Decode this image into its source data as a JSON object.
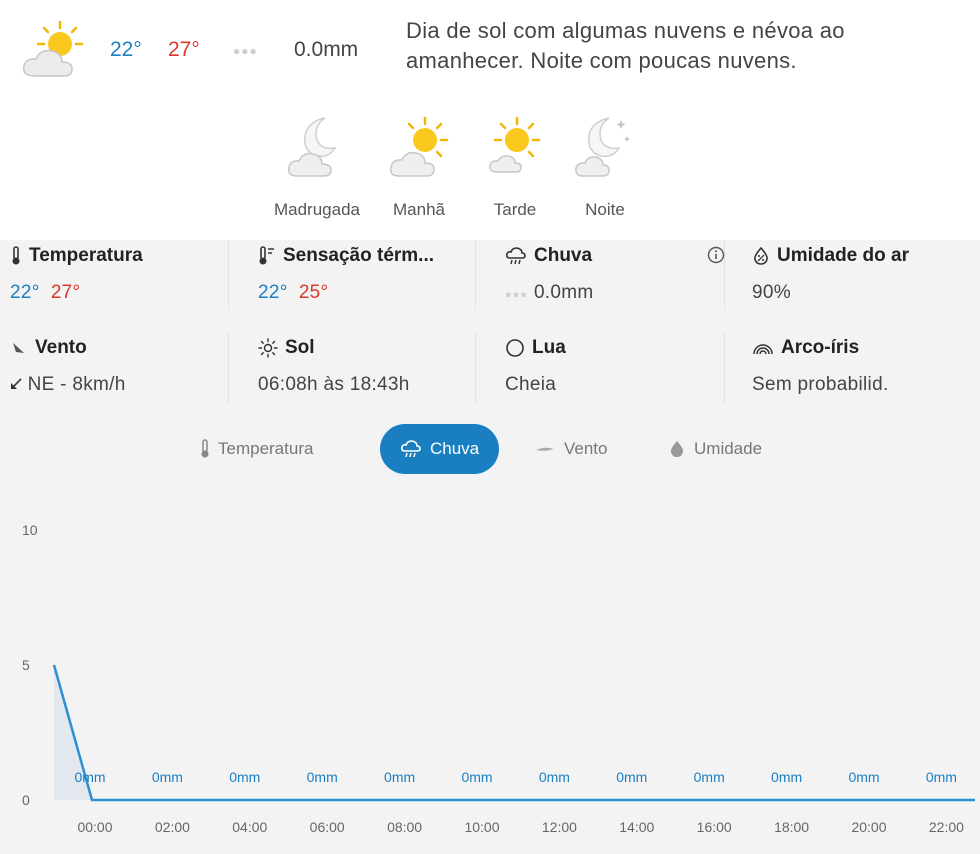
{
  "summary": {
    "temp_min": "22°",
    "temp_max": "27°",
    "rain_dots": "●●●",
    "rain": "0.0mm",
    "description": "Dia de sol com algumas nuvens e névoa ao amanhecer. Noite com poucas nuvens.",
    "icon": "sun-behind-cloud-icon"
  },
  "periods": [
    {
      "label": "Madrugada",
      "icon": "moon-cloud-icon"
    },
    {
      "label": "Manhã",
      "icon": "sun-cloud-icon"
    },
    {
      "label": "Tarde",
      "icon": "sun-small-cloud-icon"
    },
    {
      "label": "Noite",
      "icon": "moon-stars-icon"
    }
  ],
  "details": {
    "temperatura": {
      "title": "Temperatura",
      "min": "22°",
      "max": "27°"
    },
    "sensacao": {
      "title": "Sensação térm...",
      "min": "22°",
      "max": "25°"
    },
    "chuva": {
      "title": "Chuva",
      "dots": "●●●",
      "value": "0.0mm"
    },
    "umidade": {
      "title": "Umidade do ar",
      "value": "90%"
    },
    "vento": {
      "title": "Vento",
      "value": "NE - 8km/h"
    },
    "sol": {
      "title": "Sol",
      "value": "06:08h às 18:43h"
    },
    "lua": {
      "title": "Lua",
      "value": "Cheia"
    },
    "arco": {
      "title": "Arco-íris",
      "value": "Sem probabilid."
    }
  },
  "tabs": [
    {
      "label": "Temperatura",
      "active": false
    },
    {
      "label": "Chuva",
      "active": true
    },
    {
      "label": "Vento",
      "active": false
    },
    {
      "label": "Umidade",
      "active": false
    }
  ],
  "colors": {
    "accent": "#1a7fc1",
    "max": "#d9372b",
    "line": "#2b8fd6"
  },
  "chart_data": {
    "type": "area",
    "x": [
      "00:00",
      "02:00",
      "04:00",
      "06:00",
      "08:00",
      "10:00",
      "12:00",
      "14:00",
      "16:00",
      "18:00",
      "20:00",
      "22:00"
    ],
    "yticks": [
      0,
      5,
      10
    ],
    "ylim": [
      0,
      10
    ],
    "start_value": 5,
    "values": [
      0,
      0,
      0,
      0,
      0,
      0,
      0,
      0,
      0,
      0,
      0,
      0
    ],
    "data_labels": [
      "0mm",
      "0mm",
      "0mm",
      "0mm",
      "0mm",
      "0mm",
      "0mm",
      "0mm",
      "0mm",
      "0mm",
      "0mm",
      "0mm"
    ]
  }
}
